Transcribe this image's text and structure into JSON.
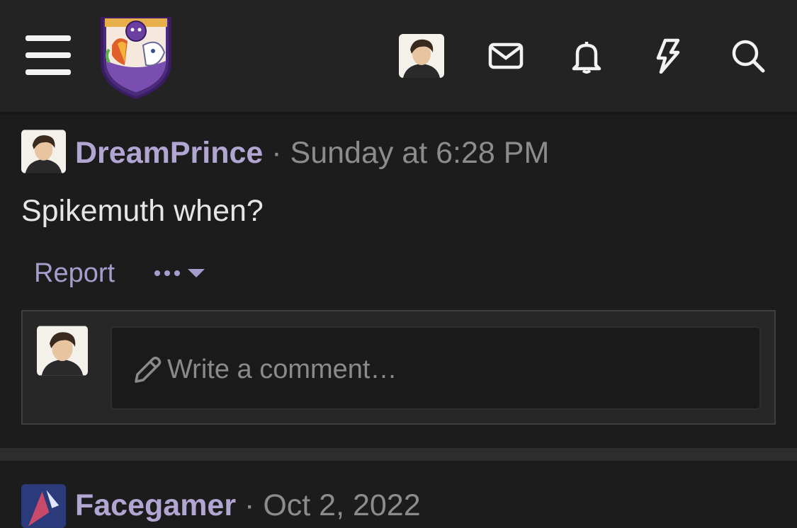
{
  "header": {
    "menu_icon": "hamburger-icon",
    "logo": "site-logo-crest",
    "icons": [
      "avatar",
      "envelope-icon",
      "bell-icon",
      "bolt-icon",
      "search-icon"
    ]
  },
  "post": {
    "username": "DreamPrince",
    "separator": "·",
    "timestamp": "Sunday at 6:28 PM",
    "text": "Spikemuth when?",
    "report_label": "Report",
    "more_icon": "ellipsis-dropdown-icon"
  },
  "comment": {
    "placeholder": "Write a comment…"
  },
  "next_post": {
    "username": "Facegamer",
    "separator": "·",
    "timestamp": "Oct 2, 2022"
  },
  "colors": {
    "background": "#1c1c1d",
    "header": "#232324",
    "username": "#b1a6d2",
    "link": "#a79dcc",
    "muted": "#8c8c8c"
  }
}
